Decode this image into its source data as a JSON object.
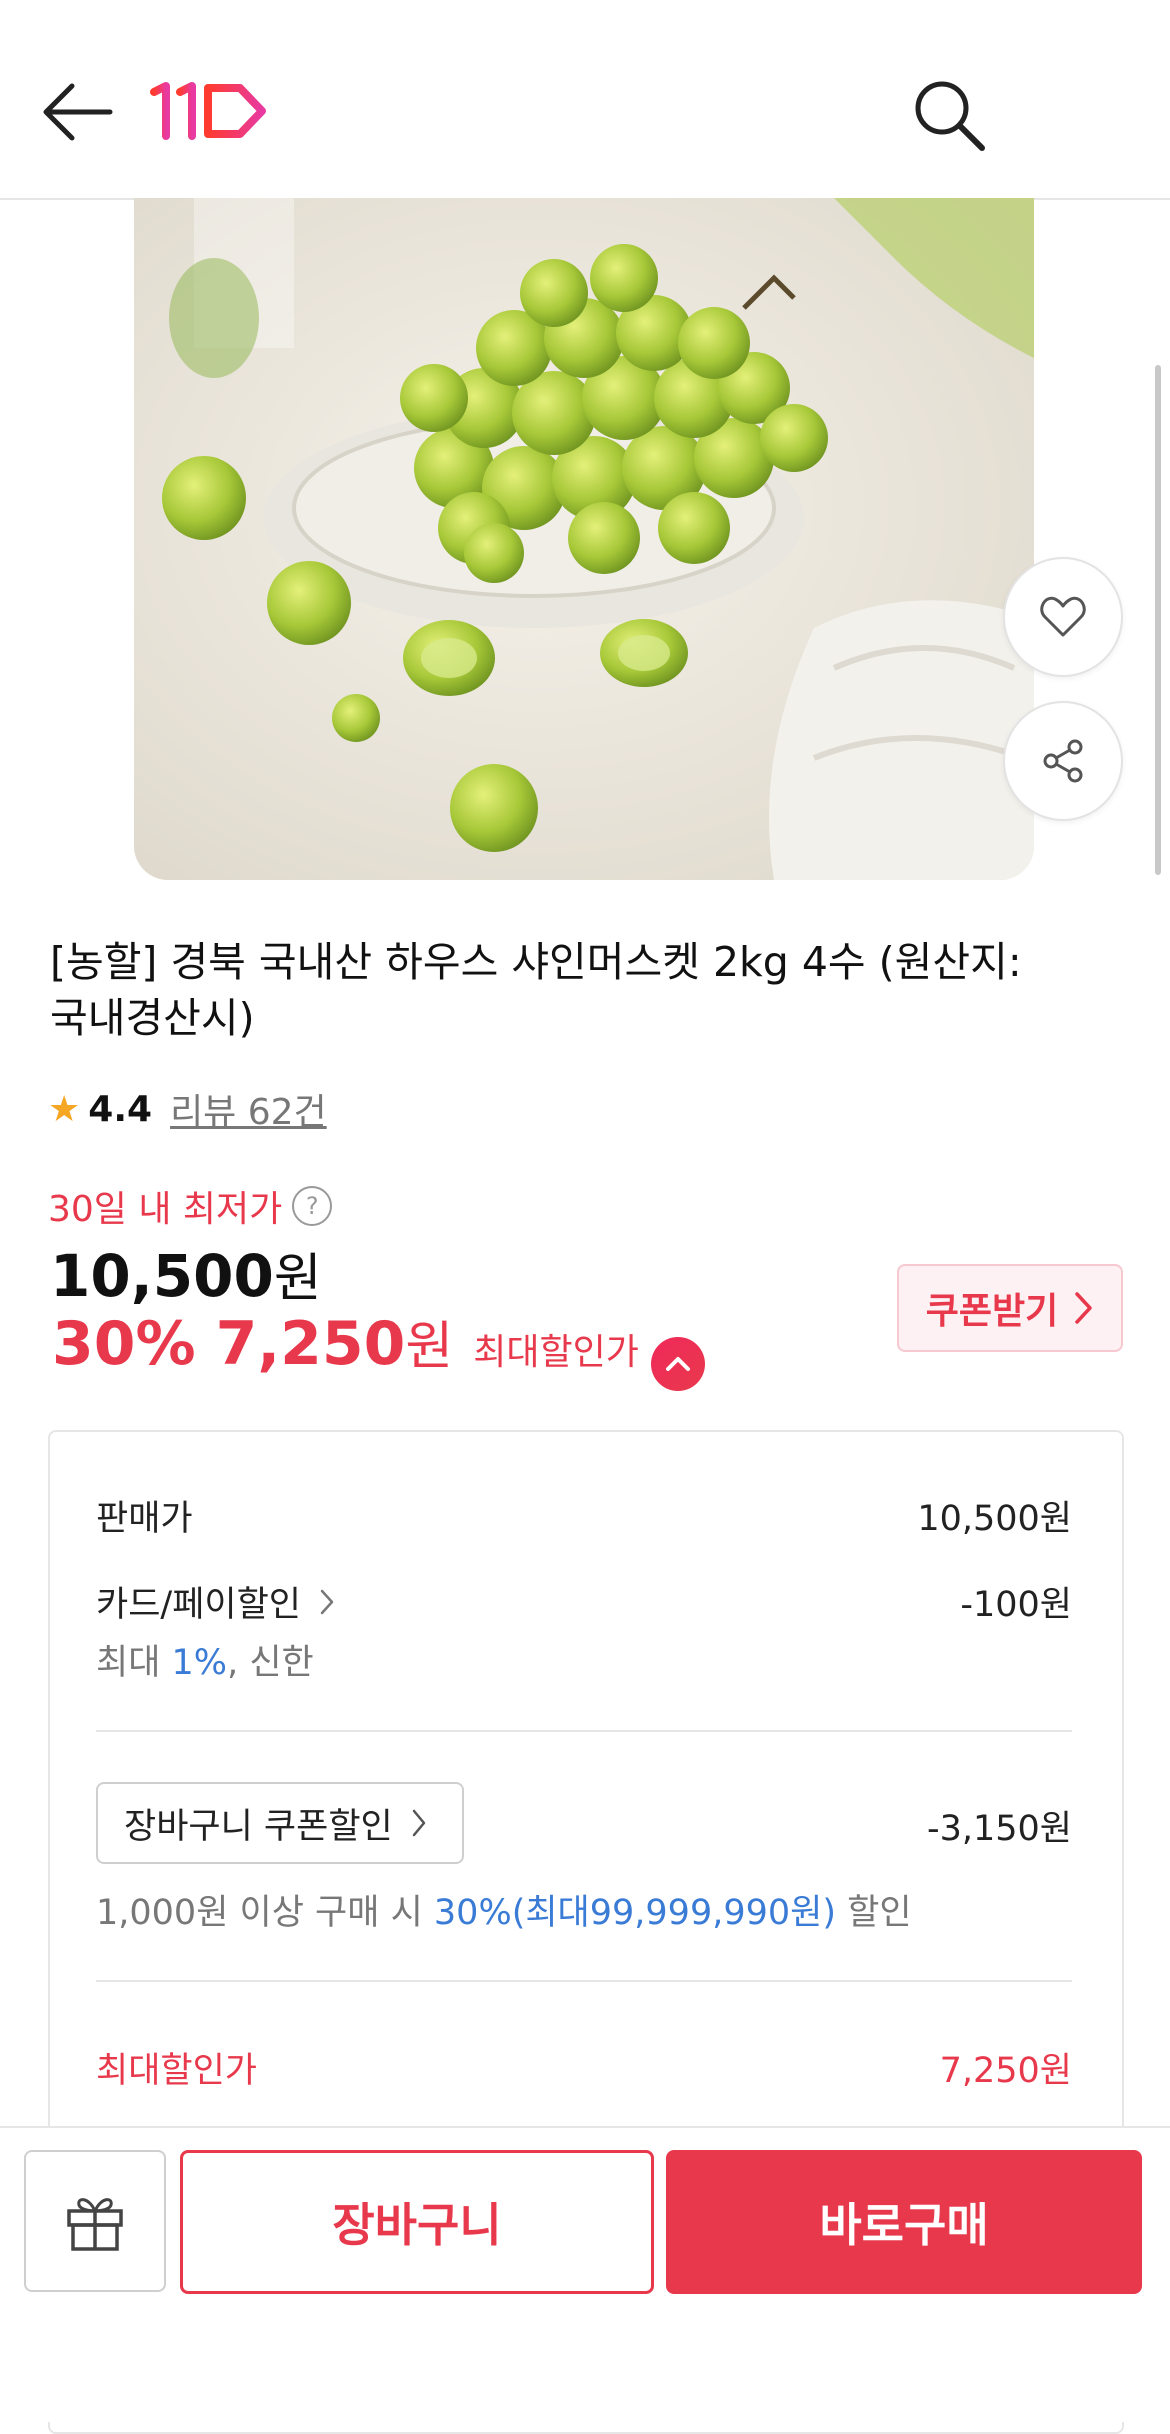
{
  "header": {
    "back_icon": "arrow-left-icon",
    "logo_text": "11",
    "search_icon": "search-icon"
  },
  "product": {
    "image_icon": "shine-muscat-grapes-photo",
    "title": "[농할] 경북 국내산 하우스 샤인머스켓 2kg 4수 (원산지: 국내경산시)",
    "rating": "4.4",
    "reviews": "리뷰 62건"
  },
  "pricing": {
    "lowest_label": "30일 내 최저가",
    "help_icon": "?",
    "original_price": "10,500",
    "original_unit": "원",
    "discount_pct": "30%",
    "sale_price": "7,250",
    "sale_unit": "원",
    "max_label": "최대할인가",
    "coupon_button": "쿠폰받기"
  },
  "detail": {
    "sale_label": "판매가",
    "sale_value": "10,500원",
    "card_label": "카드/페이할인",
    "card_value": "-100원",
    "card_sub_prefix": "최대 ",
    "card_sub_pct": "1%",
    "card_sub_suffix": ", 신한",
    "cart_coupon_label": "장바구니 쿠폰할인",
    "cart_coupon_value": "-3,150원",
    "coupon_sub_prefix": "1,000원 이상 구매 시 ",
    "coupon_sub_highlight": "30%(최대99,999,990원)",
    "coupon_sub_suffix": " 할인",
    "max_label": "최대할인가",
    "max_value": "7,250원"
  },
  "bottom": {
    "gift_icon": "gift-icon",
    "cart_button": "장바구니",
    "buy_button": "바로구매"
  },
  "colors": {
    "accent": "#e8394c",
    "link_blue": "#3a7bd5",
    "star": "#f5a623"
  }
}
